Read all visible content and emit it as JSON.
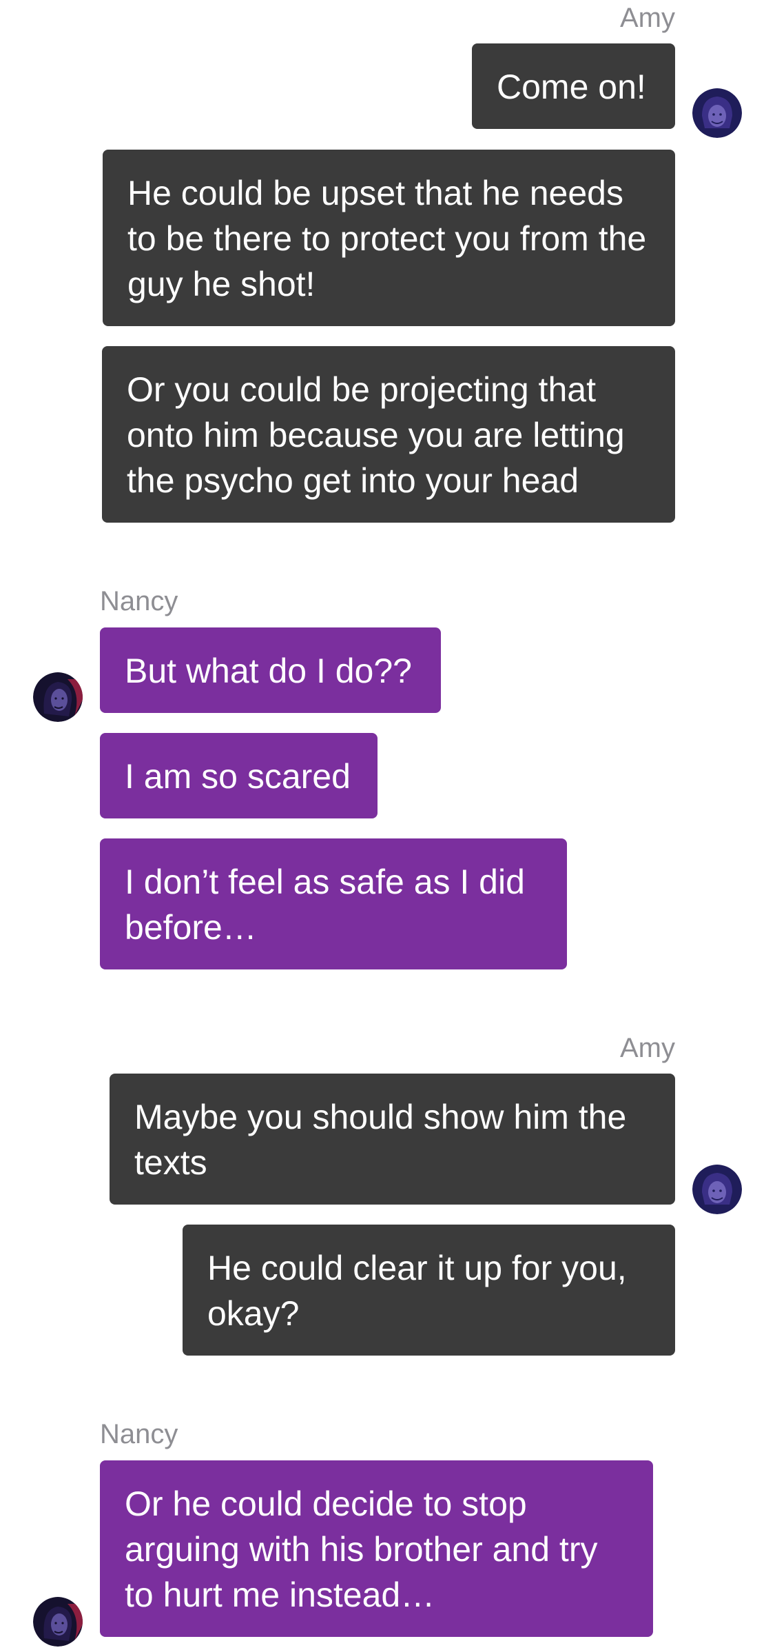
{
  "conversation": [
    {
      "sender": "Amy",
      "side": "right",
      "messages": [
        "Come on!",
        "He could be upset that he needs to be there to protect you from the guy he shot!",
        "Or you could be projecting that onto him because you are letting the psycho get into your head"
      ]
    },
    {
      "sender": "Nancy",
      "side": "left",
      "messages": [
        "But what do I do??",
        "I am so scared",
        "I don’t feel as safe as I did before…"
      ]
    },
    {
      "sender": "Amy",
      "side": "right",
      "messages": [
        "Maybe you should show him the texts",
        "He could clear it up for you, okay?"
      ]
    },
    {
      "sender": "Nancy",
      "side": "left",
      "messages": [
        "Or he could decide to stop arguing with his brother and try to hurt me instead…"
      ]
    }
  ],
  "colors": {
    "outgoing_bubble": "#3b3b3b",
    "incoming_bubble": "#7b2f9e",
    "sender_name": "#8e8e93"
  },
  "icons": {
    "amy_avatar": "amy-avatar-icon",
    "nancy_avatar": "nancy-avatar-icon"
  }
}
